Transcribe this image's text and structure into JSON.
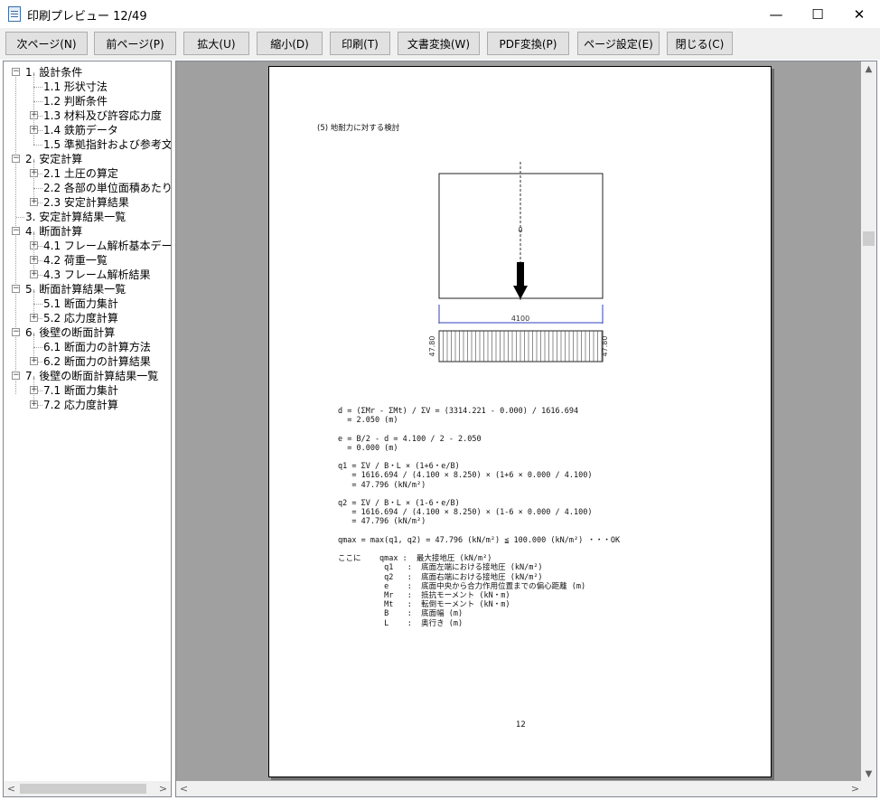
{
  "window": {
    "title": "印刷プレビュー 12/49",
    "minimize_glyph": "—",
    "maximize_glyph": "☐",
    "close_glyph": "✕"
  },
  "toolbar": {
    "buttons": [
      "次ページ(N)",
      "前ページ(P)",
      "拡大(U)",
      "縮小(D)",
      "印刷(T)",
      "文書変換(W)",
      "PDF変換(P)",
      "ページ設定(E)",
      "閉じる(C)"
    ]
  },
  "tree": {
    "items": [
      {
        "label": "1. 設計条件",
        "level": 0,
        "expander": "−"
      },
      {
        "label": "1.1 形状寸法",
        "level": 1,
        "expander": ""
      },
      {
        "label": "1.2 判断条件",
        "level": 1,
        "expander": ""
      },
      {
        "label": "1.3 材料及び許容応力度",
        "level": 1,
        "expander": "+"
      },
      {
        "label": "1.4 鉄筋データ",
        "level": 1,
        "expander": "+"
      },
      {
        "label": "1.5 準拠指針および参考文献",
        "level": 1,
        "expander": ""
      },
      {
        "label": "2. 安定計算",
        "level": 0,
        "expander": "−"
      },
      {
        "label": "2.1 土圧の算定",
        "level": 1,
        "expander": "+"
      },
      {
        "label": "2.2 各部の単位面積あたり重量",
        "level": 1,
        "expander": ""
      },
      {
        "label": "2.3 安定計算結果",
        "level": 1,
        "expander": "+"
      },
      {
        "label": "3. 安定計算結果一覧",
        "level": 0,
        "expander": ""
      },
      {
        "label": "4. 断面計算",
        "level": 0,
        "expander": "−"
      },
      {
        "label": "4.1 フレーム解析基本データ",
        "level": 1,
        "expander": "+"
      },
      {
        "label": "4.2 荷重一覧",
        "level": 1,
        "expander": "+"
      },
      {
        "label": "4.3 フレーム解析結果",
        "level": 1,
        "expander": "+"
      },
      {
        "label": "5. 断面計算結果一覧",
        "level": 0,
        "expander": "−"
      },
      {
        "label": "5.1 断面力集計",
        "level": 1,
        "expander": ""
      },
      {
        "label": "5.2 応力度計算",
        "level": 1,
        "expander": "+"
      },
      {
        "label": "6. 後壁の断面計算",
        "level": 0,
        "expander": "−"
      },
      {
        "label": "6.1 断面力の計算方法",
        "level": 1,
        "expander": ""
      },
      {
        "label": "6.2 断面力の計算結果",
        "level": 1,
        "expander": "+"
      },
      {
        "label": "7. 後壁の断面計算結果一覧",
        "level": 0,
        "expander": "−"
      },
      {
        "label": "7.1 断面力集計",
        "level": 1,
        "expander": "+"
      },
      {
        "label": "7.2 応力度計算",
        "level": 1,
        "expander": "+"
      }
    ]
  },
  "page": {
    "heading": "(5) 地耐力に対する検討",
    "diagram": {
      "center_label": "0",
      "width_dim": "4100",
      "left_pressure": "47.80",
      "right_pressure": "47.80"
    },
    "formulas": [
      "d = (ΣMr - ΣMt) / ΣV = (3314.221 - 0.000) / 1616.694",
      "  = 2.050 (m)",
      "",
      "e = B/2 - d = 4.100 / 2 - 2.050",
      "  = 0.000 (m)",
      "",
      "q1 = ΣV / B・L × (1+6・e/B)",
      "   = 1616.694 / (4.100 × 8.250) × (1+6 × 0.000 / 4.100)",
      "   = 47.796 (kN/m²)",
      "",
      "q2 = ΣV / B・L × (1-6・e/B)",
      "   = 1616.694 / (4.100 × 8.250) × (1-6 × 0.000 / 4.100)",
      "   = 47.796 (kN/m²)",
      "",
      "qmax = max(q1, q2) = 47.796 (kN/m²) ≦ 100.000 (kN/m²) ・・・OK",
      "",
      "ここに    qmax :  最大接地圧 (kN/m²)",
      "          q1   :  底面左端における接地圧 (kN/m²)",
      "          q2   :  底面右端における接地圧 (kN/m²)",
      "          e    :  底面中央から合力作用位置までの偏心距離 (m)",
      "          Mr   :  抵抗モーメント (kN・m)",
      "          Mt   :  転倒モーメント (kN・m)",
      "          B    :  底面幅 (m)",
      "          L    :  奥行き (m)"
    ],
    "page_number": "12"
  },
  "scroll_glyphs": {
    "left": "<",
    "right": ">",
    "up": "▲",
    "down": "▼"
  }
}
